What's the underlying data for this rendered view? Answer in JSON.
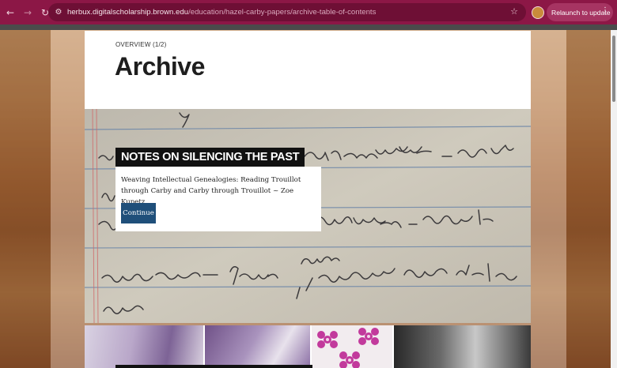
{
  "browser": {
    "url_host": "herbux.digitalscholarship.brown.edu",
    "url_path": "/education/hazel-carby-papers/archive-table-of-contents",
    "relaunch_label": "Relaunch to update"
  },
  "header": {
    "eyebrow": "OVERVIEW (1/2)",
    "title": "Archive"
  },
  "feature": {
    "tag": "NOTES ON SILENCING THE PAST",
    "description": "Weaving Intellectual Genealogies: Reading Trouillot through Carby and Carby through Trouillot ~ Zoe Kupetz",
    "button_label": "Continue"
  },
  "colors": {
    "chrome": "#8c1746",
    "button": "#1f4f7a",
    "tag_bg": "#111111"
  },
  "icons": [
    "back-arrow-icon",
    "forward-arrow-icon",
    "reload-icon",
    "site-info-icon",
    "star-icon",
    "profile-avatar-icon",
    "kebab-menu-icon"
  ]
}
